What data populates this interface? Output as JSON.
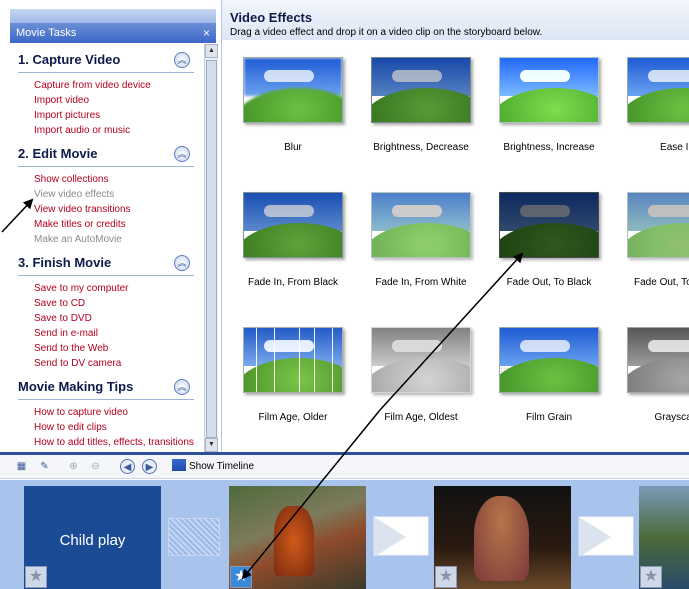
{
  "tasks_pane": {
    "title": "Movie Tasks",
    "close": "×",
    "sections": [
      {
        "title": "1. Capture Video",
        "links": [
          {
            "label": "Capture from video device",
            "dim": false
          },
          {
            "label": "Import video",
            "dim": false
          },
          {
            "label": "Import pictures",
            "dim": false
          },
          {
            "label": "Import audio or music",
            "dim": false
          }
        ]
      },
      {
        "title": "2. Edit Movie",
        "links": [
          {
            "label": "Show collections",
            "dim": false
          },
          {
            "label": "View video effects",
            "dim": true
          },
          {
            "label": "View video transitions",
            "dim": false
          },
          {
            "label": "Make titles or credits",
            "dim": false
          },
          {
            "label": "Make an AutoMovie",
            "dim": true
          }
        ]
      },
      {
        "title": "3. Finish Movie",
        "links": [
          {
            "label": "Save to my computer",
            "dim": false
          },
          {
            "label": "Save to CD",
            "dim": false
          },
          {
            "label": "Save to DVD",
            "dim": false
          },
          {
            "label": "Send in e-mail",
            "dim": false
          },
          {
            "label": "Send to the Web",
            "dim": false
          },
          {
            "label": "Send to DV camera",
            "dim": false
          }
        ]
      },
      {
        "title": "Movie Making Tips",
        "links": [
          {
            "label": "How to capture video",
            "dim": false
          },
          {
            "label": "How to edit clips",
            "dim": false
          },
          {
            "label": "How to add titles, effects, transitions",
            "dim": false
          }
        ]
      }
    ]
  },
  "content": {
    "title": "Video Effects",
    "description": "Drag a video effect and drop it on a video clip on the storyboard below.",
    "effects": [
      {
        "label": "Blur",
        "style": "t-blur"
      },
      {
        "label": "Brightness, Decrease",
        "style": "t-bdec"
      },
      {
        "label": "Brightness, Increase",
        "style": "t-binc"
      },
      {
        "label": "Ease In",
        "style": "t-ease"
      },
      {
        "label": "Fade In, From Black",
        "style": "t-fb"
      },
      {
        "label": "Fade In, From White",
        "style": "t-fw"
      },
      {
        "label": "Fade Out, To Black",
        "style": "t-fo"
      },
      {
        "label": "Fade Out, To White",
        "style": "t-fow"
      },
      {
        "label": "Film Age, Older",
        "style": "t-old"
      },
      {
        "label": "Film Age, Oldest",
        "style": "t-oldest"
      },
      {
        "label": "Film Grain",
        "style": "t-grain"
      },
      {
        "label": "Grayscale",
        "style": "t-gray"
      }
    ]
  },
  "toolbar": {
    "show_timeline": "Show Timeline"
  },
  "storyboard": {
    "title_clip_text": "Child play"
  },
  "colors": {
    "link": "#b3001f",
    "link_dim": "#8a8a8a",
    "storyboard_bg": "#a8c4ec",
    "divider": "#2c4f9a"
  }
}
